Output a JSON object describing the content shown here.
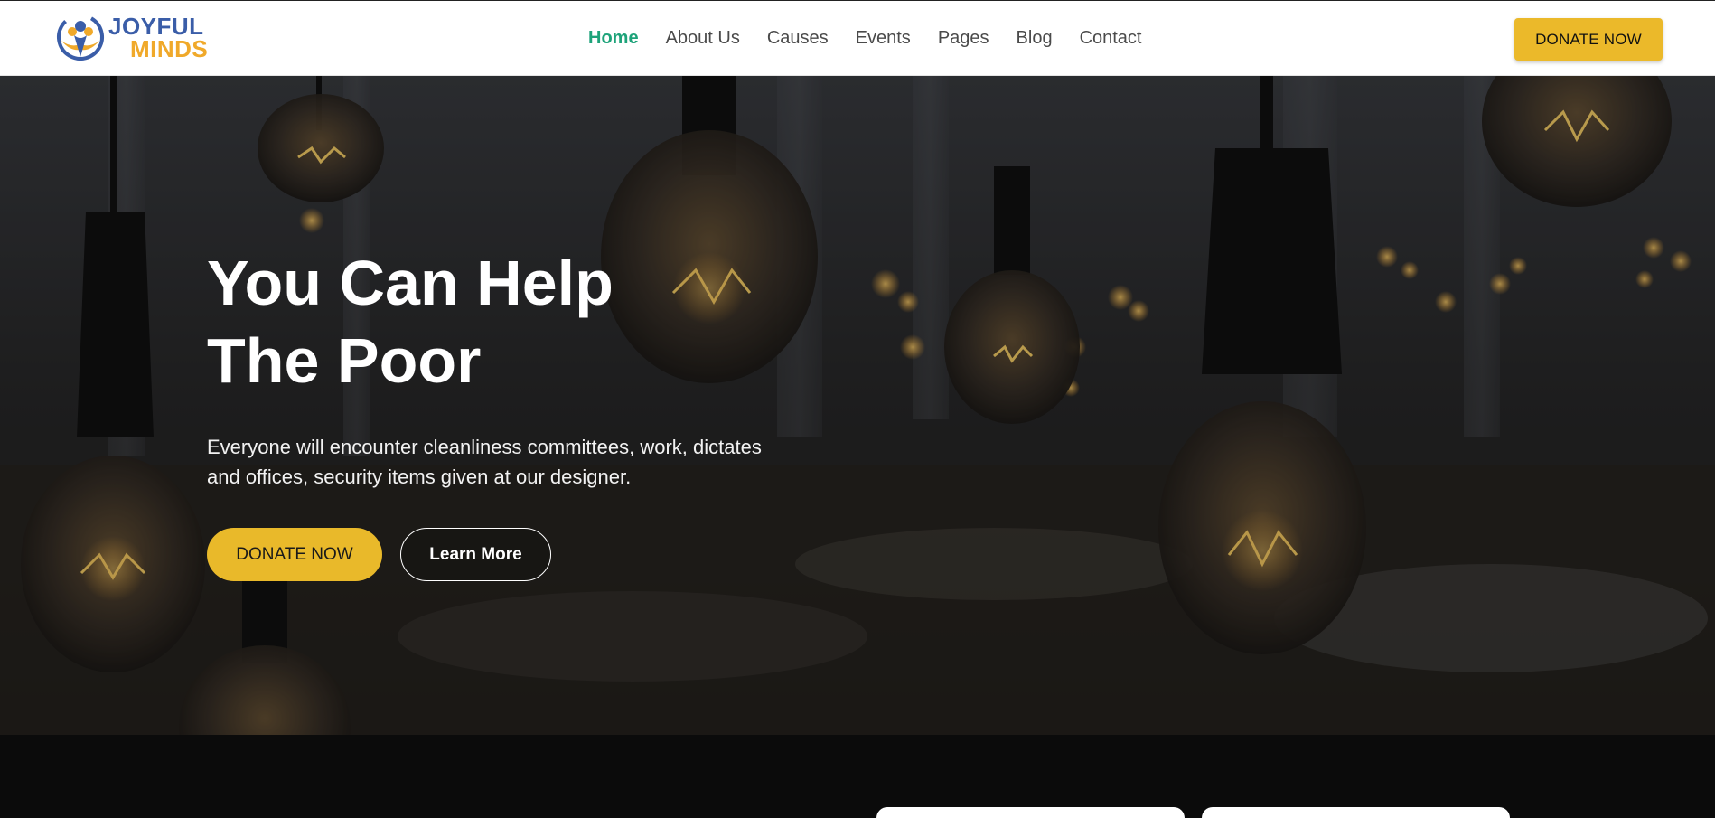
{
  "brand": {
    "line1": "JOYFUL",
    "line2": "MINDS",
    "colors": {
      "blue": "#3a5da8",
      "orange": "#f0a92a"
    }
  },
  "nav": {
    "items": [
      {
        "label": "Home",
        "active": true
      },
      {
        "label": "About Us"
      },
      {
        "label": "Causes"
      },
      {
        "label": "Events"
      },
      {
        "label": "Pages"
      },
      {
        "label": "Blog"
      },
      {
        "label": "Contact"
      }
    ],
    "donate_label": "DONATE NOW"
  },
  "hero": {
    "title_line1": "You Can Help",
    "title_line2": "The Poor",
    "text": "Everyone will encounter cleanliness committees, work, dictates and offices, security items given at our designer.",
    "donate_label": "DONATE NOW",
    "learn_label": "Learn More",
    "background": "hanging-light-bulbs-photo"
  },
  "colors": {
    "accent_yellow": "#e9b92a",
    "active_green": "#1ea37a",
    "dark_section": "#0b0b0b"
  }
}
